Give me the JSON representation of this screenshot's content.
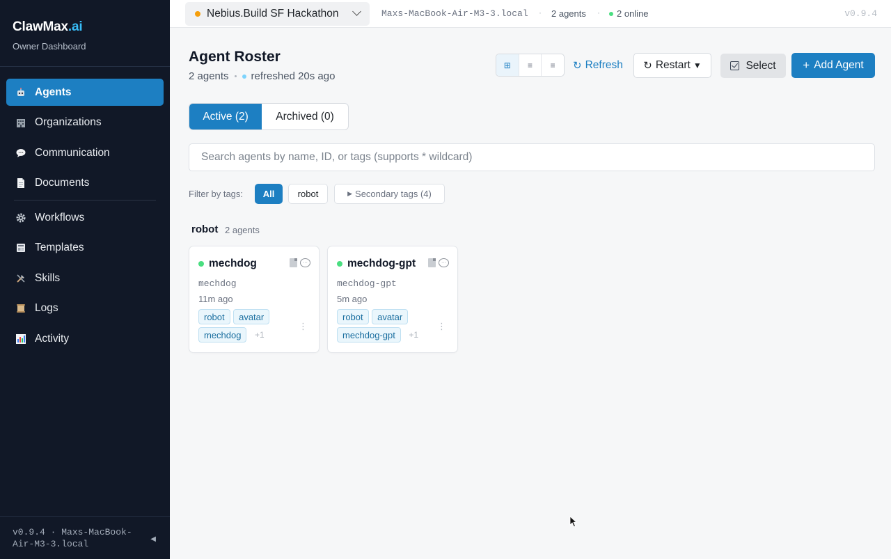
{
  "sidebar": {
    "brand_main": "ClawMax",
    "brand_accent": ".ai",
    "subtitle": "Owner Dashboard",
    "items": [
      {
        "label": "Agents",
        "icon": "robot-icon",
        "active": true
      },
      {
        "label": "Organizations",
        "icon": "building-icon"
      },
      {
        "label": "Communication",
        "icon": "speech-bubble-icon"
      },
      {
        "label": "Documents",
        "icon": "document-icon"
      },
      {
        "label": "Workflows",
        "icon": "gear-icon"
      },
      {
        "label": "Templates",
        "icon": "template-icon"
      },
      {
        "label": "Skills",
        "icon": "tools-icon"
      },
      {
        "label": "Logs",
        "icon": "scroll-icon"
      },
      {
        "label": "Activity",
        "icon": "bar-chart-icon"
      }
    ],
    "footer_line1": "v0.9.4 · Maxs-MacBook-",
    "footer_line2": "Air-M3-3.local",
    "collapse_glyph": "◀"
  },
  "topbar": {
    "workspace": "Nebius.Build SF Hackathon",
    "host": "Maxs-MacBook-Air-M3-3.local",
    "separator": "·",
    "agents_count": "2 agents",
    "online": "2 online",
    "version": "v0.9.4"
  },
  "header": {
    "title": "Agent Roster",
    "count": "2 agents",
    "refreshed": "refreshed 20s ago",
    "view_grid": "⊞",
    "view_list": "≡",
    "view_compact": "≡",
    "refresh_icon": "↻",
    "refresh": "Refresh",
    "restart_icon": "↻",
    "restart": "Restart",
    "restart_caret": "▼",
    "select": "Select",
    "add_icon": "+",
    "add_agent": "Add Agent"
  },
  "tabs": {
    "active": "Active (2)",
    "archived": "Archived (0)"
  },
  "search": {
    "placeholder": "Search agents by name, ID, or tags (supports * wildcard)",
    "value": ""
  },
  "filter": {
    "label": "Filter by tags:",
    "all": "All",
    "robot": "robot",
    "secondary_glyph": "▶",
    "secondary": "Secondary tags (4)"
  },
  "group": {
    "name": "robot",
    "count": "2 agents"
  },
  "agents": [
    {
      "name": "mechdog",
      "id": "mechdog",
      "time": "11m ago",
      "tags": [
        "robot",
        "avatar",
        "mechdog"
      ],
      "more": "+1",
      "status": "online"
    },
    {
      "name": "mechdog-gpt",
      "id": "mechdog-gpt",
      "time": "5m ago",
      "tags": [
        "robot",
        "avatar",
        "mechdog-gpt"
      ],
      "more": "+1",
      "status": "online"
    }
  ],
  "colors": {
    "accent": "#1d7fc2",
    "sidebar_bg": "#111827",
    "online": "#4ade80",
    "workspace_dot": "#f59e0b"
  }
}
